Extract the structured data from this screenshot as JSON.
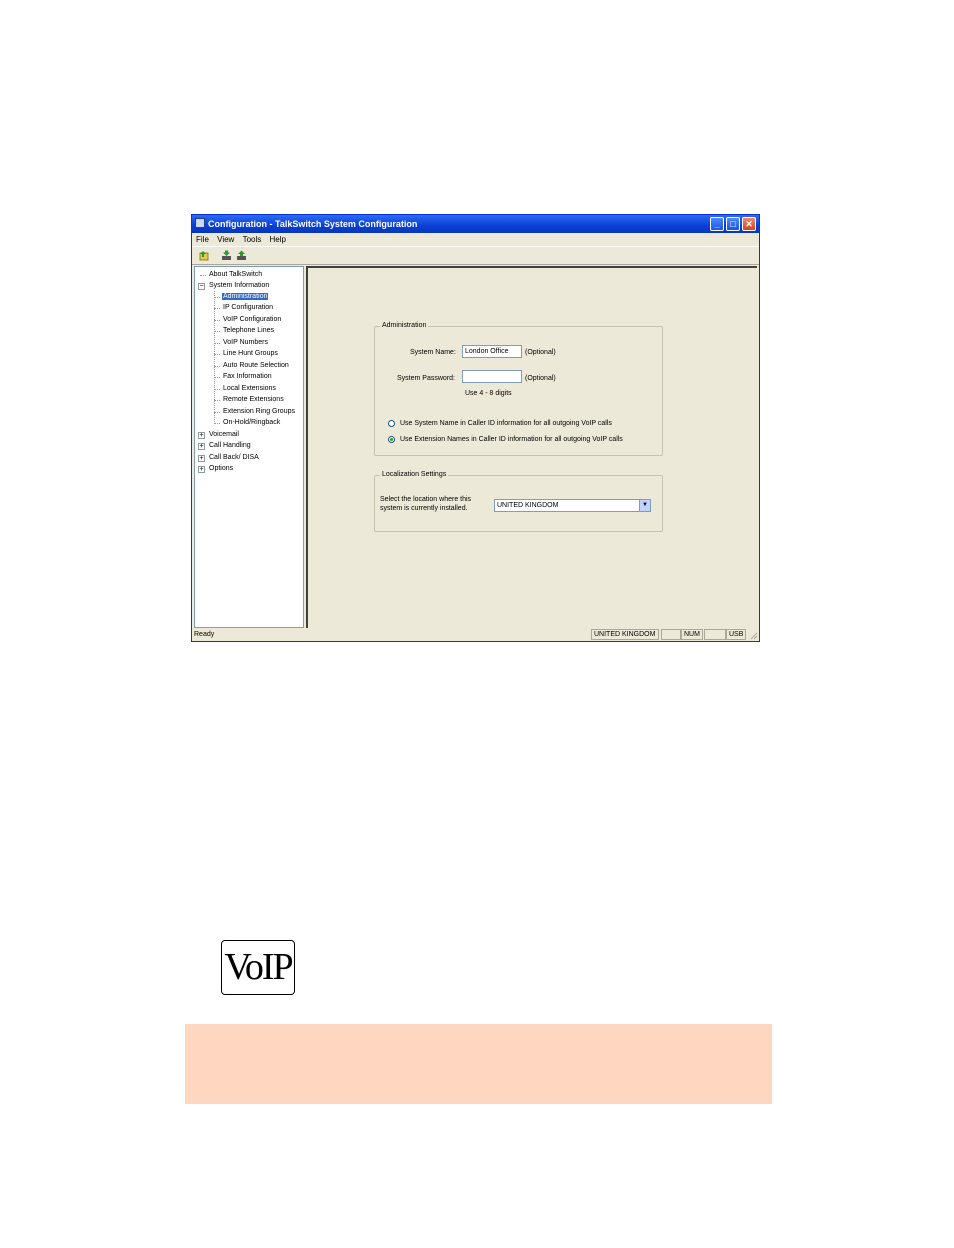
{
  "window": {
    "title": "Configuration - TalkSwitch System Configuration",
    "controls": {
      "minimize": "_",
      "maximize": "□",
      "close": "✕"
    }
  },
  "menu": [
    "File",
    "View",
    "Tools",
    "Help"
  ],
  "tree": {
    "about": "About TalkSwitch",
    "system_information": "System Information",
    "children": [
      "Administration",
      "IP Configuration",
      "VoIP Configuration",
      "Telephone Lines",
      "VoIP Numbers",
      "Line Hunt Groups",
      "Auto Route Selection",
      "Fax Information",
      "Local Extensions",
      "Remote Extensions",
      "Extension Ring Groups",
      "On-Hold/Ringback"
    ],
    "other": [
      "Voicemail",
      "Call Handling",
      "Call Back/ DISA",
      "Options"
    ],
    "expand_plus": "+",
    "expand_minus": "−"
  },
  "administration": {
    "group_label": "Administration",
    "system_name_label": "System Name:",
    "system_name_value": "London Office",
    "optional1": "(Optional)",
    "password_label": "System Password:",
    "password_value": "",
    "optional2": "(Optional)",
    "password_hint": "Use 4 - 8 digits",
    "radio1": "Use System Name in Caller ID information for all outgoing VoIP calls",
    "radio2": "Use Extension Names in Caller ID information for all outgoing VoIP calls",
    "radio_selected": 2
  },
  "localization": {
    "group_label": "Localization Settings",
    "prompt_line1": "Select the location where this",
    "prompt_line2": "system is currently installed.",
    "country": "UNITED KINGDOM",
    "dropdown_arrow": "▼"
  },
  "status": {
    "text": "Ready",
    "country": "UNITED KINGDOM",
    "num": "NUM",
    "port": "USB"
  },
  "logo": {
    "text": "VoIP"
  },
  "colors": {
    "band": "#ffd6bf",
    "selection": "#316ac5",
    "titlebar": "#0a3fd6"
  }
}
